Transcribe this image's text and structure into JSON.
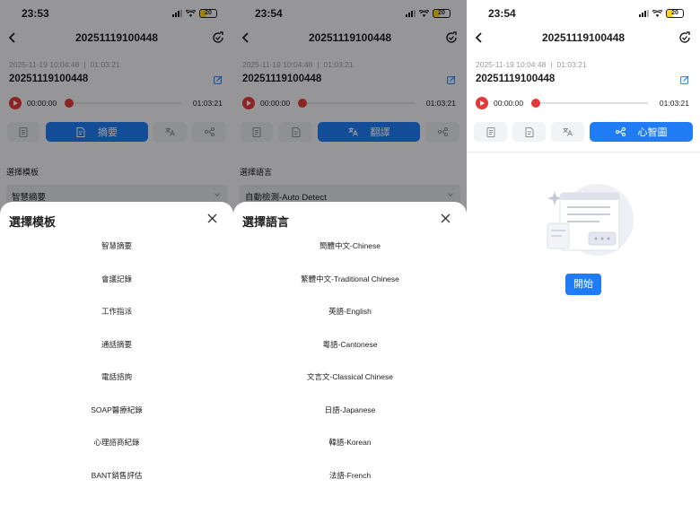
{
  "status": {
    "time_1": "23:53",
    "time_2": "23:54",
    "time_3": "23:54",
    "battery": "20"
  },
  "nav": {
    "title": "20251119100448"
  },
  "recording": {
    "meta_date": "2025-11-19 10:04:48",
    "meta_sep": "|",
    "meta_duration": "01:03:21",
    "title": "20251119100448",
    "current_time": "00:00:00",
    "total_time": "01:03:21",
    "progress": 0
  },
  "tabs": {
    "summary": "摘要",
    "translate": "翻譯",
    "mindmap": "心智圖"
  },
  "panel_template": {
    "section_label": "選擇模板",
    "selected": "智慧摘要",
    "sheet_title": "選擇模板",
    "options": [
      "智慧摘要",
      "會議記錄",
      "工作指派",
      "通話摘要",
      "電話諮詢",
      "SOAP醫療紀錄",
      "心理諮商紀錄",
      "BANT銷售評估"
    ]
  },
  "panel_language": {
    "section_label": "選擇語言",
    "selected": "自動檢測-Auto Detect",
    "sheet_title": "選擇語言",
    "options": [
      "簡體中文-Chinese",
      "繁體中文-Traditional Chinese",
      "英語-English",
      "粵語-Cantonese",
      "文言文-Classical Chinese",
      "日語-Japanese",
      "韓語-Korean",
      "法語-French"
    ]
  },
  "panel_mindmap": {
    "start_label": "開始"
  },
  "colors": {
    "accent": "#1f7cf4",
    "record": "#e23a3a",
    "overlay": "rgba(0,0,0,0.38)"
  },
  "icons": [
    "back-arrow-icon",
    "refresh-check-icon",
    "edit-square-icon",
    "play-icon",
    "transcript-icon",
    "summary-icon",
    "translate-icon",
    "mindmap-icon",
    "close-icon",
    "chevron-down-icon"
  ]
}
